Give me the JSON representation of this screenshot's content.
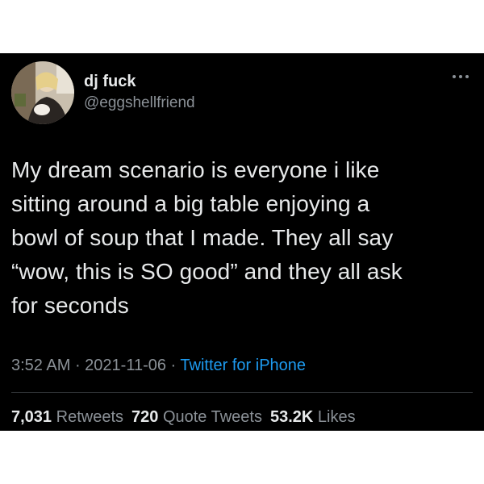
{
  "tweet": {
    "author": {
      "display_name": "dj fuck",
      "handle": "@eggshellfriend",
      "avatar_icon": "avatar-photo"
    },
    "more_icon": "more-dots-icon",
    "text": "My dream scenario is everyone i like\nsitting around a big table enjoying a\nbowl of soup that I made. They all say\n“wow, this is SO good” and they all ask\nfor seconds",
    "time": "3:52 AM",
    "separator": " · ",
    "date": "2021-11-06",
    "source": "Twitter for iPhone",
    "stats": {
      "retweets_count": "7,031",
      "retweets_label": "Retweets",
      "quotes_count": "720",
      "quotes_label": "Quote Tweets",
      "likes_count": "53.2K",
      "likes_label": "Likes"
    }
  },
  "colors": {
    "background": "#000000",
    "text": "#e7e9ea",
    "muted": "#8b9197",
    "link": "#1d9bf0"
  }
}
